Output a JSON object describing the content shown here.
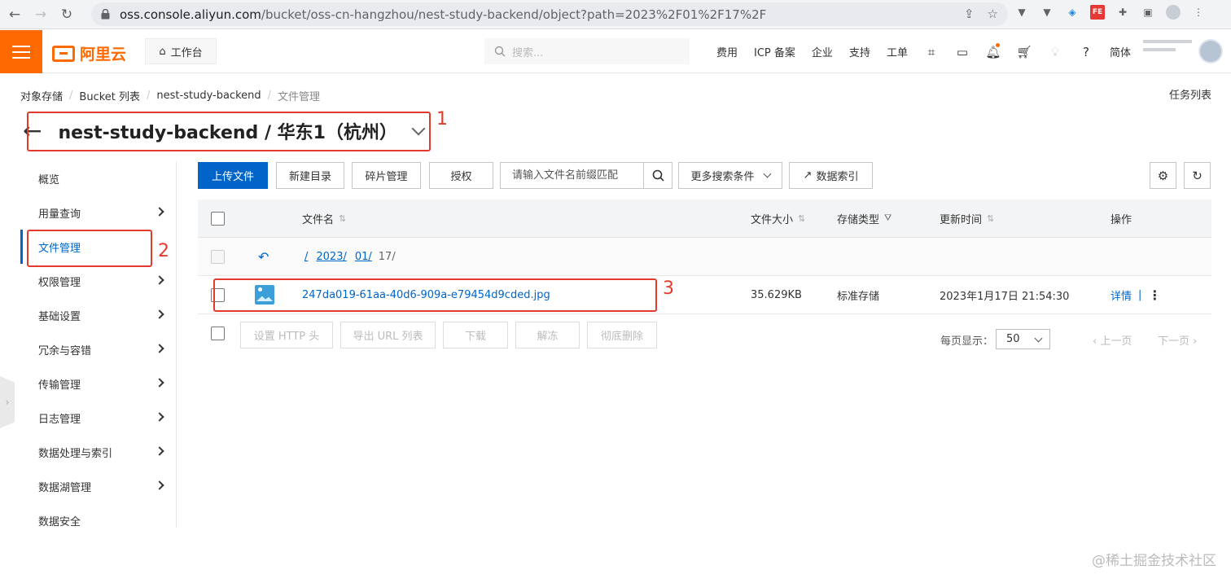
{
  "browser": {
    "url_host": "oss.console.aliyun.com",
    "url_path": "/bucket/oss-cn-hangzhou/nest-study-backend/object?path=2023%2F01%2F17%2F",
    "fe_badge": "FE"
  },
  "topbar": {
    "logo_text": "阿里云",
    "workbench": "工作台",
    "search_placeholder": "搜索...",
    "nav": [
      "费用",
      "ICP 备案",
      "企业",
      "支持",
      "工单"
    ],
    "lang": "简体"
  },
  "breadcrumb": [
    "对象存储",
    "Bucket 列表",
    "nest-study-backend",
    "文件管理"
  ],
  "task_list": "任务列表",
  "title": "nest-study-backend / 华东1（杭州）",
  "annotations": [
    "1",
    "2",
    "3"
  ],
  "sidebar": {
    "items": [
      {
        "label": "概览",
        "chevron": false
      },
      {
        "label": "用量查询",
        "chevron": true
      },
      {
        "label": "文件管理",
        "chevron": false,
        "active": true
      },
      {
        "label": "权限管理",
        "chevron": true
      },
      {
        "label": "基础设置",
        "chevron": true
      },
      {
        "label": "冗余与容错",
        "chevron": true
      },
      {
        "label": "传输管理",
        "chevron": true
      },
      {
        "label": "日志管理",
        "chevron": true
      },
      {
        "label": "数据处理与索引",
        "chevron": true
      },
      {
        "label": "数据湖管理",
        "chevron": true
      },
      {
        "label": "数据安全",
        "chevron": false
      }
    ]
  },
  "toolbar": {
    "upload": "上传文件",
    "new_dir": "新建目录",
    "fragments": "碎片管理",
    "authorize": "授权",
    "prefix_placeholder": "请输入文件名前缀匹配",
    "more_search": "更多搜索条件",
    "data_index": "数据索引"
  },
  "table": {
    "headers": {
      "name": "文件名",
      "size": "文件大小",
      "storage": "存储类型",
      "updated": "更新时间",
      "ops": "操作"
    },
    "path": {
      "root": "/",
      "seg1": "2023/",
      "seg2": "01/",
      "seg3": "17/"
    },
    "files": [
      {
        "name": "247da019-61aa-40d6-909a-e79454d9cded.jpg",
        "size": "35.629KB",
        "storage": "标准存储",
        "updated": "2023年1月17日 21:54:30",
        "detail": "详情",
        "sep": "|"
      }
    ]
  },
  "footer": {
    "set_http": "设置 HTTP 头",
    "export_url": "导出 URL 列表",
    "download": "下载",
    "unfreeze": "解冻",
    "delete": "彻底删除",
    "page_size_label": "每页显示：",
    "page_size": "50",
    "prev": "上一页",
    "next": "下一页"
  },
  "watermark": "@稀土掘金技术社区"
}
